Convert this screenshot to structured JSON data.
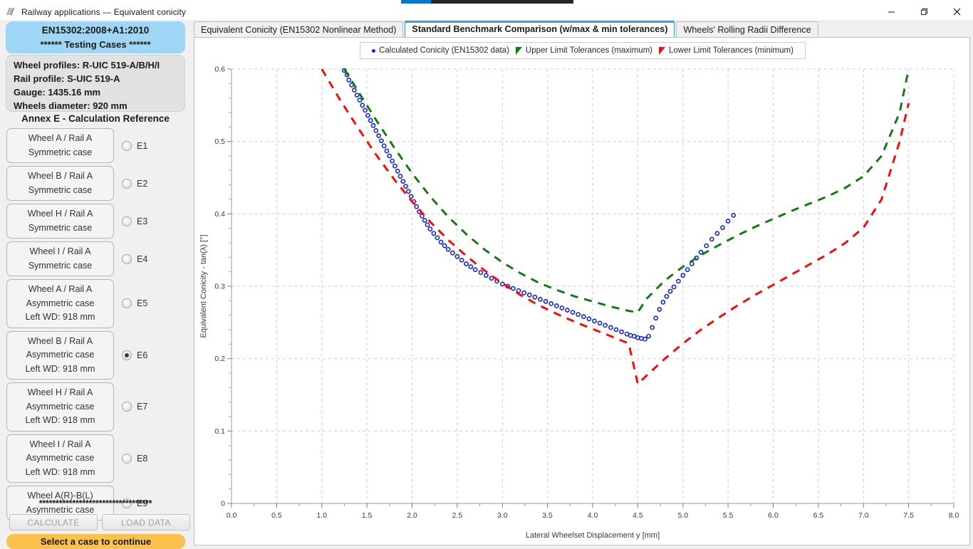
{
  "window": {
    "title": "Railway applications — Equivalent conicity",
    "icon": "app-icon",
    "minimize": "—",
    "maximize": "❐",
    "close": "✕"
  },
  "sidebar": {
    "header_line1": "EN15302:2008+A1:2010",
    "header_line2": "****** Testing Cases ******",
    "info": [
      "Wheel profiles: R-UIC 519-A/B/H/I",
      "Rail profile: S-UIC 519-A",
      "Gauge: 1435.16 mm",
      "Wheels diameter: 920 mm"
    ],
    "annex_title": "Annex E - Calculation Reference",
    "cases": [
      {
        "id": "E1",
        "lines": [
          "Wheel A / Rail A",
          "Symmetric case"
        ],
        "selected": false
      },
      {
        "id": "E2",
        "lines": [
          "Wheel B / Rail A",
          "Symmetric case"
        ],
        "selected": false
      },
      {
        "id": "E3",
        "lines": [
          "Wheel H / Rail A",
          "Symmetric case"
        ],
        "selected": false
      },
      {
        "id": "E4",
        "lines": [
          "Wheel I / Rail A",
          "Symmetric case"
        ],
        "selected": false
      },
      {
        "id": "E5",
        "lines": [
          "Wheel A / Rail A",
          "Asymmetric case",
          "Left WD: 918 mm"
        ],
        "selected": false
      },
      {
        "id": "E6",
        "lines": [
          "Wheel B / Rail A",
          "Asymmetric case",
          "Left WD: 918 mm"
        ],
        "selected": true
      },
      {
        "id": "E7",
        "lines": [
          "Wheel H / Rail A",
          "Asymmetric case",
          "Left WD: 918 mm"
        ],
        "selected": false
      },
      {
        "id": "E8",
        "lines": [
          "Wheel I / Rail A",
          "Asymmetric case",
          "Left WD: 918 mm"
        ],
        "selected": false
      },
      {
        "id": "E9",
        "lines": [
          "Wheel A(R)-B(L)",
          "Asymmetric case"
        ],
        "selected": false
      }
    ],
    "divider": "**********************************",
    "calculate_label": "CALCULATE",
    "load_data_label": "LOAD DATA",
    "status_label": "Select a case to continue"
  },
  "tabs": [
    {
      "label": "Equivalent Conicity (EN15302 Nonlinear Method)",
      "active": false
    },
    {
      "label": "Standard Benchmark Comparison (w/max & min tolerances)",
      "active": true
    },
    {
      "label": "Wheels' Rolling Radii Difference",
      "active": false
    }
  ],
  "colors": {
    "calculated": "#1226d8",
    "upper": "#157a15",
    "lower": "#fb0a0a",
    "accent": "#3b9ee0",
    "header_bg": "#9fd6f5",
    "status_bg": "#fbc14d",
    "grid": "#cfcfcf"
  },
  "chart_data": {
    "type": "line",
    "title": "",
    "xlabel": "Lateral Wheelset Displacement y [mm]",
    "ylabel": "Equivalent Conicity - tan(λ) [°]",
    "xlim": [
      0.0,
      8.0
    ],
    "ylim": [
      0.0,
      0.6
    ],
    "xticks": [
      "0.0",
      "0.5",
      "1.0",
      "1.5",
      "2.0",
      "2.5",
      "3.0",
      "3.5",
      "4.0",
      "4.5",
      "5.0",
      "5.5",
      "6.0",
      "6.5",
      "7.0",
      "7.5",
      "8.0"
    ],
    "yticks": [
      "0",
      "0.1",
      "0.2",
      "0.3",
      "0.4",
      "0.5",
      "0.6"
    ],
    "xtick_values": [
      0.0,
      0.5,
      1.0,
      1.5,
      2.0,
      2.5,
      3.0,
      3.5,
      4.0,
      4.5,
      5.0,
      5.5,
      6.0,
      6.5,
      7.0,
      7.5,
      8.0
    ],
    "ytick_values": [
      0,
      0.1,
      0.2,
      0.3,
      0.4,
      0.5,
      0.6
    ],
    "grid": true,
    "legend_position": "top-center",
    "series": [
      {
        "name": "Calculated Conicity (EN15302 data)",
        "color": "#1226d8",
        "style": "markers",
        "marker": "circle-open",
        "x": [
          1.25,
          1.28,
          1.3,
          1.33,
          1.36,
          1.39,
          1.42,
          1.45,
          1.48,
          1.51,
          1.54,
          1.57,
          1.6,
          1.63,
          1.66,
          1.69,
          1.72,
          1.75,
          1.78,
          1.81,
          1.84,
          1.87,
          1.9,
          1.93,
          1.96,
          1.99,
          2.02,
          2.05,
          2.08,
          2.11,
          2.14,
          2.17,
          2.2,
          2.24,
          2.28,
          2.32,
          2.36,
          2.4,
          2.45,
          2.5,
          2.55,
          2.6,
          2.65,
          2.7,
          2.76,
          2.82,
          2.88,
          2.94,
          3.0,
          3.06,
          3.12,
          3.18,
          3.24,
          3.3,
          3.36,
          3.42,
          3.48,
          3.54,
          3.6,
          3.66,
          3.72,
          3.78,
          3.84,
          3.9,
          3.96,
          4.02,
          4.08,
          4.14,
          4.2,
          4.26,
          4.32,
          4.38,
          4.42,
          4.46,
          4.5,
          4.54,
          4.58,
          4.62,
          4.66,
          4.7,
          4.74,
          4.78,
          4.82,
          4.86,
          4.9,
          4.95,
          5.0,
          5.05,
          5.1,
          5.15,
          5.2,
          5.26,
          5.32,
          5.38,
          5.44,
          5.5,
          5.56
        ],
        "y": [
          0.598,
          0.592,
          0.585,
          0.578,
          0.571,
          0.564,
          0.557,
          0.55,
          0.543,
          0.536,
          0.529,
          0.522,
          0.515,
          0.508,
          0.501,
          0.494,
          0.487,
          0.48,
          0.473,
          0.466,
          0.459,
          0.452,
          0.445,
          0.438,
          0.431,
          0.424,
          0.417,
          0.41,
          0.403,
          0.397,
          0.391,
          0.385,
          0.379,
          0.373,
          0.367,
          0.361,
          0.356,
          0.351,
          0.346,
          0.341,
          0.336,
          0.331,
          0.327,
          0.323,
          0.319,
          0.315,
          0.311,
          0.307,
          0.303,
          0.3,
          0.297,
          0.294,
          0.291,
          0.288,
          0.285,
          0.282,
          0.279,
          0.276,
          0.273,
          0.27,
          0.267,
          0.264,
          0.261,
          0.258,
          0.255,
          0.252,
          0.249,
          0.246,
          0.243,
          0.24,
          0.237,
          0.234,
          0.232,
          0.231,
          0.229,
          0.228,
          0.227,
          0.231,
          0.243,
          0.256,
          0.268,
          0.278,
          0.286,
          0.293,
          0.299,
          0.307,
          0.315,
          0.323,
          0.331,
          0.339,
          0.347,
          0.356,
          0.365,
          0.373,
          0.381,
          0.39,
          0.398
        ]
      },
      {
        "name": "Upper Limit Tolerances (maximum)",
        "color": "#157a15",
        "style": "dashed",
        "x": [
          1.25,
          1.4,
          1.6,
          1.8,
          2.0,
          2.2,
          2.4,
          2.6,
          2.8,
          3.0,
          3.2,
          3.4,
          3.6,
          3.8,
          4.0,
          4.2,
          4.4,
          4.5,
          4.6,
          4.8,
          5.0,
          5.2,
          5.4,
          5.6,
          5.8,
          6.0,
          6.2,
          6.4,
          6.6,
          6.8,
          7.0,
          7.2,
          7.4,
          7.5
        ],
        "y": [
          0.6,
          0.57,
          0.53,
          0.492,
          0.456,
          0.424,
          0.396,
          0.372,
          0.351,
          0.333,
          0.318,
          0.305,
          0.295,
          0.286,
          0.279,
          0.272,
          0.266,
          0.264,
          0.283,
          0.308,
          0.327,
          0.343,
          0.357,
          0.37,
          0.382,
          0.393,
          0.404,
          0.414,
          0.424,
          0.436,
          0.452,
          0.48,
          0.54,
          0.6
        ]
      },
      {
        "name": "Lower Limit Tolerances (minimum)",
        "color": "#fb0a0a",
        "style": "dashed",
        "x": [
          1.0,
          1.2,
          1.4,
          1.6,
          1.8,
          2.0,
          2.2,
          2.4,
          2.6,
          2.8,
          3.0,
          3.2,
          3.4,
          3.6,
          3.8,
          4.0,
          4.2,
          4.4,
          4.5,
          4.6,
          4.8,
          5.0,
          5.2,
          5.4,
          5.6,
          5.8,
          6.0,
          6.2,
          6.4,
          6.6,
          6.8,
          7.0,
          7.2,
          7.4,
          7.5
        ],
        "y": [
          0.6,
          0.558,
          0.519,
          0.482,
          0.448,
          0.417,
          0.389,
          0.364,
          0.342,
          0.322,
          0.304,
          0.288,
          0.274,
          0.262,
          0.251,
          0.241,
          0.231,
          0.221,
          0.165,
          0.177,
          0.2,
          0.221,
          0.24,
          0.257,
          0.273,
          0.288,
          0.302,
          0.316,
          0.33,
          0.344,
          0.36,
          0.381,
          0.42,
          0.5,
          0.553
        ]
      }
    ]
  }
}
